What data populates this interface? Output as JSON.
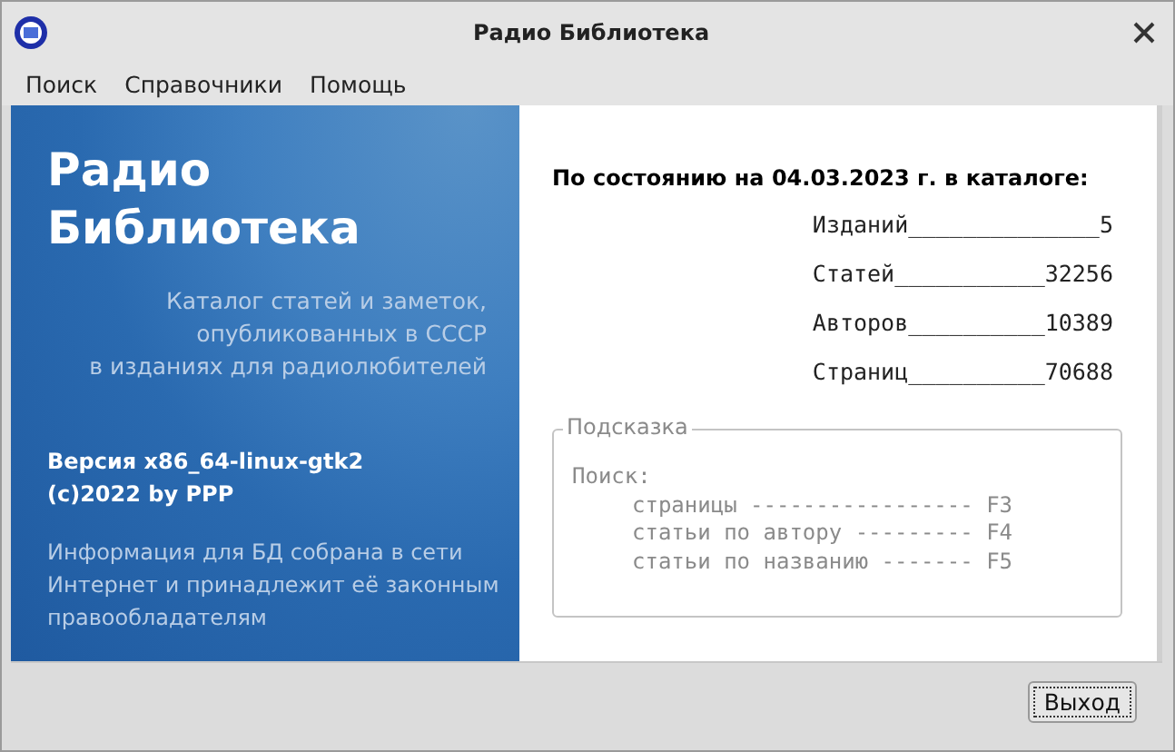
{
  "window": {
    "title": "Радио Библиотека"
  },
  "menu": [
    {
      "label": "Поиск"
    },
    {
      "label": "Справочники"
    },
    {
      "label": "Помощь"
    }
  ],
  "banner": {
    "title_lines": [
      "Радио",
      "Библиотека"
    ],
    "subtitle_lines": [
      "Каталог статей и заметок,",
      "опубликованных в СССР",
      "в изданиях для радиолюбителей"
    ],
    "version_lines": [
      "Версия x86_64-linux-gtk2",
      "(c)2022 by PPP"
    ],
    "notice_lines": [
      "Информация для БД собрана в сети",
      "Интернет и принадлежит её законным",
      "правообладателям"
    ]
  },
  "stats": {
    "heading": "По состоянию на 04.03.2023  г. в каталоге:",
    "rows": [
      "Изданий______________5",
      "Статей___________32256",
      "Авторов__________10389",
      "Страниц__________70688"
    ]
  },
  "hint": {
    "title": "Подсказка",
    "heading": "Поиск:",
    "lines": [
      "страницы ----------------- F3",
      "статьи по автору --------- F4",
      "статьи по названию ------- F5"
    ]
  },
  "buttons": [
    {
      "label": "Выход",
      "focused": true
    }
  ]
}
